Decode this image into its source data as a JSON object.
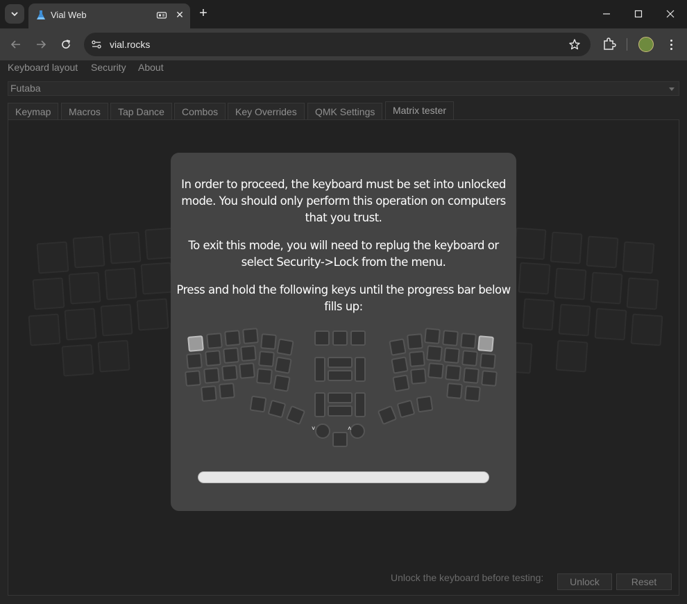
{
  "browser": {
    "tab_title": "Vial Web",
    "url": "vial.rocks"
  },
  "app": {
    "menu": [
      "Keyboard layout",
      "Security",
      "About"
    ],
    "keyboard_select": "Futaba",
    "tabs": [
      "Keymap",
      "Macros",
      "Tap Dance",
      "Combos",
      "Key Overrides",
      "QMK Settings",
      "Matrix tester"
    ],
    "active_tab": "Matrix tester",
    "footer": {
      "hint": "Unlock the keyboard before testing:",
      "unlock_label": "Unlock",
      "reset_label": "Reset"
    }
  },
  "modal": {
    "para1_line1": "In order to proceed, the keyboard must be set into unlocked",
    "para1_line2": "mode. You should only perform this operation on computers",
    "para1_line3": "that you trust.",
    "para2_line1": "To exit this mode, you will need to replug the keyboard or",
    "para2_line2": "select Security->Lock from the menu.",
    "para3_line1": "Press and hold the following keys until the progress bar below",
    "para3_line2": "fills up:",
    "progress": 0,
    "encoder_left_glyph": "˅",
    "encoder_right_glyph": "˄"
  },
  "colors": {
    "highlight_key": "#9a9a9a",
    "modal_bg": "#444444"
  }
}
